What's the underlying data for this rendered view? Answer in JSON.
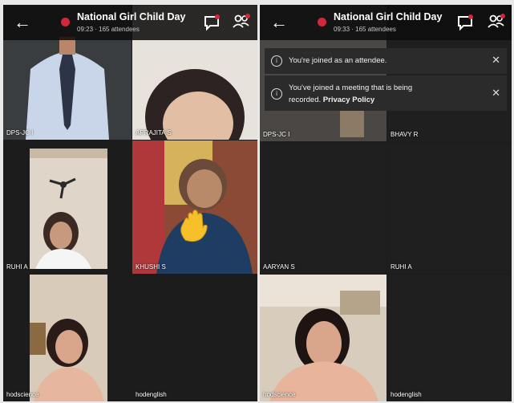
{
  "left_window": {
    "back_icon": "arrow-left-icon",
    "title": "National Girl Child Day",
    "subtitle": "09:23 · 165 attendees",
    "tiles": [
      {
        "name": "DPS-JC I"
      },
      {
        "name": "APRAJITA S"
      },
      {
        "name": "RUHI A"
      },
      {
        "name": "KHUSHI S"
      },
      {
        "name": "hodscience"
      },
      {
        "name": "hodenglish"
      }
    ]
  },
  "right_window": {
    "title": "National Girl Child Day",
    "subtitle": "09:33 · 165 attendees",
    "banners": [
      {
        "text": "You're joined as an attendee."
      },
      {
        "text": "You've joined a meeting that is being",
        "text2": "recorded.",
        "link": "Privacy Policy"
      }
    ],
    "tiles": [
      {
        "name": "DPS-JC I"
      },
      {
        "name": "BHAVY R"
      },
      {
        "name": "AARYAN S"
      },
      {
        "name": "RUHI A"
      },
      {
        "name": "hodscience"
      },
      {
        "name": "hodenglish"
      }
    ]
  },
  "colors": {
    "background": "#1c1c1c",
    "recording": "#d4273a",
    "raised_hand": "#f5c02a",
    "selection": "#6a6ad8"
  }
}
